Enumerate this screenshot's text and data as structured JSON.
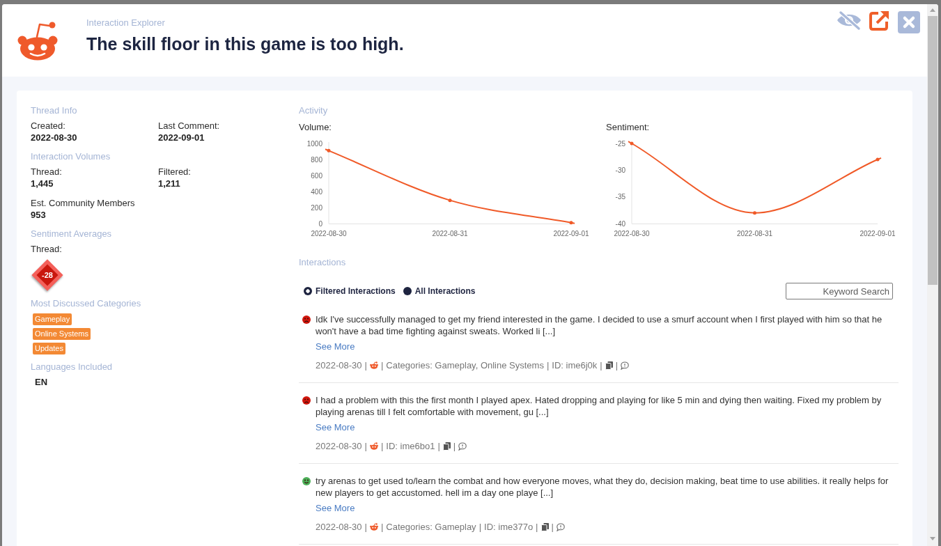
{
  "window": {
    "subtitle": "Interaction Explorer",
    "title": "The skill floor in this game is too high."
  },
  "thread_panel": {
    "sections": [
      {
        "kind": "fields",
        "heading": "Thread Info",
        "fields": [
          {
            "label": "Created:",
            "value": "2022-08-30"
          },
          {
            "label": "Last Comment:",
            "value": "2022-09-01"
          }
        ]
      },
      {
        "kind": "fields",
        "heading": "Interaction Volumes",
        "fields": [
          {
            "label": "Thread:",
            "value": "1,445"
          },
          {
            "label": "Filtered:",
            "value": "1,211"
          },
          {
            "label": "Est. Community Members",
            "value": "953"
          }
        ]
      },
      {
        "kind": "score",
        "heading": "Sentiment Averages",
        "label": "Thread:",
        "score": "-28",
        "positive": false
      },
      {
        "kind": "tags",
        "heading": "Most Discussed Categories",
        "tags": [
          "Gameplay",
          "Online Systems",
          "Updates"
        ]
      },
      {
        "kind": "languages",
        "heading": "Languages Included",
        "languages": [
          "EN"
        ]
      }
    ]
  },
  "activity": {
    "heading": "Activity",
    "charts": [
      {
        "chart_data": {
          "type": "line",
          "title": "Volume:",
          "categories": [
            "2022-08-30",
            "2022-08-31",
            "2022-09-01"
          ],
          "values": [
            910,
            290,
            10
          ],
          "ylim": [
            0,
            1000
          ],
          "yticks": [
            0,
            200,
            400,
            600,
            800,
            1000
          ]
        }
      },
      {
        "chart_data": {
          "type": "line",
          "title": "Sentiment:",
          "categories": [
            "2022-08-30",
            "2022-08-31",
            "2022-09-01"
          ],
          "values": [
            -25,
            -38,
            -28
          ],
          "ylim": [
            -40,
            -25
          ],
          "yticks": [
            -40,
            -35,
            -30,
            -25
          ]
        }
      }
    ]
  },
  "interactions": {
    "heading": "Interactions",
    "filters": [
      {
        "label": "Filtered Interactions",
        "selected": true
      },
      {
        "label": "All Interactions",
        "selected": false
      }
    ],
    "search": {
      "placeholder": "Keyword Search"
    },
    "items": [
      {
        "positive": false,
        "text": "Idk I've successfully managed to get my friend interested in the game. I decided to use a smurf account when I first played with him so that he won't have a bad time fighting against sweats. Worked li [...]",
        "link": "See More",
        "meta": [
          {
            "kind": "text",
            "text": "2022-08-30"
          },
          {
            "kind": "separator",
            "text": "|"
          },
          {
            "kind": "source"
          },
          {
            "kind": "separator",
            "text": "|"
          },
          {
            "kind": "text",
            "text": "Categories: Gameplay, Online Systems"
          },
          {
            "kind": "separator",
            "text": "|"
          },
          {
            "kind": "text",
            "text": "ID: ime6j0k"
          },
          {
            "kind": "separator",
            "text": "|"
          },
          {
            "kind": "copy"
          },
          {
            "kind": "separator",
            "text": "|"
          },
          {
            "kind": "reply"
          }
        ]
      },
      {
        "positive": false,
        "text": "I had a problem with this the first month I played apex. Hated dropping and playing for like 5 min and dying then waiting. Fixed my problem by playing arenas till I felt comfortable with movement, gu [...]",
        "link": "See More",
        "meta": [
          {
            "kind": "text",
            "text": "2022-08-30"
          },
          {
            "kind": "separator",
            "text": "|"
          },
          {
            "kind": "source"
          },
          {
            "kind": "separator",
            "text": "|"
          },
          {
            "kind": "text",
            "text": "ID: ime6bo1"
          },
          {
            "kind": "separator",
            "text": "|"
          },
          {
            "kind": "copy"
          },
          {
            "kind": "separator",
            "text": "|"
          },
          {
            "kind": "reply"
          }
        ]
      },
      {
        "positive": true,
        "text": "try arenas to get used to/learn the combat and how everyone moves, what they do, decision making, beat time to use abilities. it really helps for new players to get accustomed. hell im a day one playe [...]",
        "link": "See More",
        "meta": [
          {
            "kind": "text",
            "text": "2022-08-30"
          },
          {
            "kind": "separator",
            "text": "|"
          },
          {
            "kind": "source"
          },
          {
            "kind": "separator",
            "text": "|"
          },
          {
            "kind": "text",
            "text": "Categories: Gameplay"
          },
          {
            "kind": "separator",
            "text": "|"
          },
          {
            "kind": "text",
            "text": "ID: ime377o"
          },
          {
            "kind": "separator",
            "text": "|"
          },
          {
            "kind": "copy"
          },
          {
            "kind": "separator",
            "text": "|"
          },
          {
            "kind": "reply"
          }
        ]
      }
    ]
  }
}
